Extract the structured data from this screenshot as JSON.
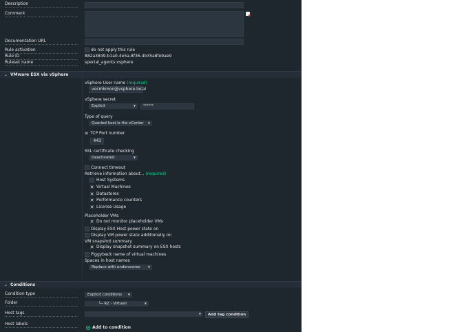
{
  "general": {
    "description_label": "Description",
    "comment_label": "Comment",
    "doc_url_label": "Documentation URL",
    "rule_activation_label": "Rule activation",
    "rule_activation_value": "do not apply this rule",
    "rule_id_label": "Rule ID",
    "rule_id_value": "882a3849-b1a0-4e5a-8f36-4b35a8fe9ae9",
    "ruleset_label": "Ruleset name",
    "ruleset_value": "special_agents:vsphere"
  },
  "vmware": {
    "section_title": "VMware ESX via vSphere",
    "username_label": "vSphere User name",
    "required": "(required)",
    "username_value": "vocmkmon@vsphere.local",
    "secret_label": "vSphere secret",
    "secret_mode": "Explicit",
    "secret_value": "******",
    "query_type_label": "Type of query",
    "query_type_value": "Queried host is the vCenter",
    "tcp_port_label": "TCP Port number",
    "tcp_port_value": "443",
    "ssl_label": "SSL certificate checking",
    "ssl_value": "Deactivated",
    "connect_timeout_label": "Connect timeout",
    "retrieve_label": "Retrieve information about...",
    "retrieve_items": [
      "Host Systems",
      "Virtual Machines",
      "Datastores",
      "Performance counters",
      "License Usage"
    ],
    "retrieve_checked": [
      false,
      true,
      true,
      true,
      true
    ],
    "placeholder_label": "Placeholder VMs",
    "placeholder_option": "Do not monitor placeholder VMs",
    "esx_power_label": "Display ESX Host power state on",
    "vm_power_label": "Display VM power state additionally on",
    "snapshot_label": "VM snapshot summary",
    "snapshot_option": "Display snapshot summary on ESX hosts",
    "piggyback_label": "Piggyback name of virtual machines",
    "spaces_label": "Spaces in host names",
    "spaces_value": "Replace with underscores"
  },
  "conditions": {
    "section_title": "Conditions",
    "condition_type_label": "Condition type",
    "condition_type_value": "Explicit conditions",
    "folder_label": "Folder",
    "folder_value": "└─ RZ - Virtuell",
    "host_tags_label": "Host tags",
    "add_tag_button": "Add tag condition",
    "host_labels_label": "Host labels",
    "add_condition": "Add to condition"
  },
  "icons": {
    "comment_icon": "note-icon",
    "section_toggle": "chevron-down-icon",
    "dropdown": "chevron-down-icon",
    "checkmark": "x-check-icon",
    "add": "plus-circle-icon"
  },
  "colors": {
    "background": "#1e262e",
    "input": "#2c3640",
    "required": "#13d389"
  }
}
